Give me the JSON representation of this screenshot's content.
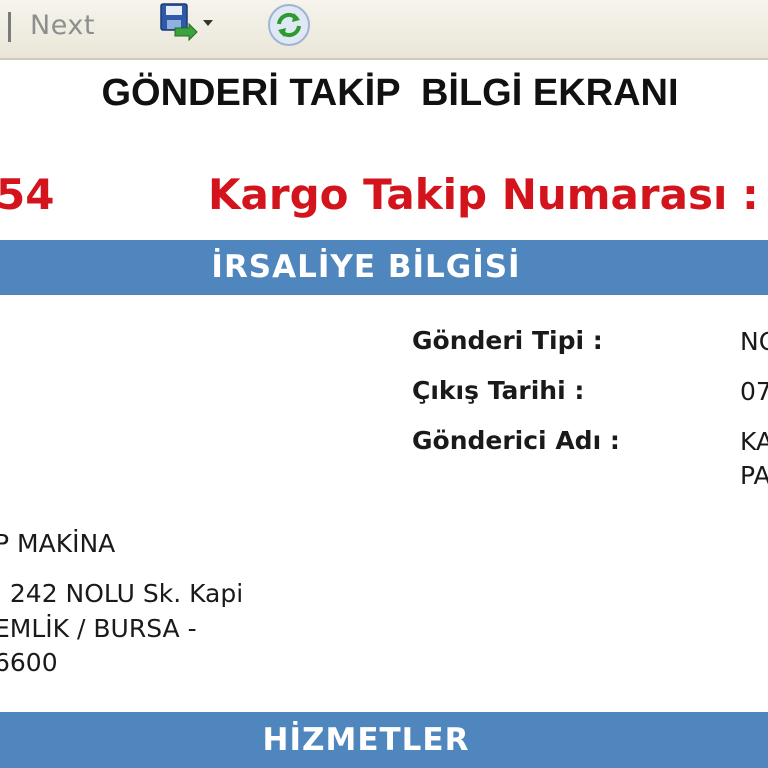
{
  "toolbar": {
    "next_label": "Next",
    "icons": [
      "save-dropdown-icon",
      "refresh-icon"
    ]
  },
  "page": {
    "title": "GÖNDERİ TAKİP  BİLGİ EKRANI",
    "tracking_fragment_left": "54",
    "tracking_label": "Kargo Takip Numarası :"
  },
  "waybill": {
    "header": "İRSALİYE BİLGİSİ",
    "fields": [
      {
        "label": "Gönderi Tipi :",
        "value": "NO"
      },
      {
        "label": "Çıkış Tarihi :",
        "value": "07"
      },
      {
        "label": "Gönderici Adı :",
        "value_line1": "KA",
        "value_line2": "PA"
      }
    ],
    "address": {
      "line1": "P MAKİNA",
      "line2": ". 242 NOLU Sk.  Kapi",
      "line3": "EMLİK / BURSA -",
      "line4": "6600"
    }
  },
  "services": {
    "header": "HİZMETLER"
  },
  "colors": {
    "accent_red": "#d3141c",
    "section_blue": "#4f86bd"
  }
}
